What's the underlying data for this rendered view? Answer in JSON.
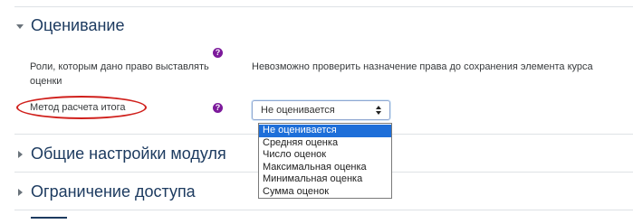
{
  "sections": {
    "grading": {
      "title": "Оценивание",
      "expanded": true
    },
    "module_settings": {
      "title": "Общие настройки модуля",
      "expanded": false
    },
    "access": {
      "title": "Ограничение доступа",
      "expanded": false
    }
  },
  "fields": {
    "roles": {
      "label_line1": "Роли, которым дано право выставлять",
      "label_line2": "оценки",
      "value": "Невозможно проверить назначение права до сохранения элемента курса"
    },
    "aggregation": {
      "label": "Метод расчета итога",
      "selected": "Не оценивается",
      "options": [
        "Не оценивается",
        "Средняя оценка",
        "Число оценок",
        "Максимальная оценка",
        "Минимальная оценка",
        "Сумма оценок"
      ]
    }
  },
  "icons": {
    "help": "?"
  },
  "colors": {
    "section_title": "#1d3b60",
    "help_icon": "#7c1a9b",
    "dropdown_highlight": "#1e6fd9",
    "annotation_oval": "#d0201c"
  }
}
